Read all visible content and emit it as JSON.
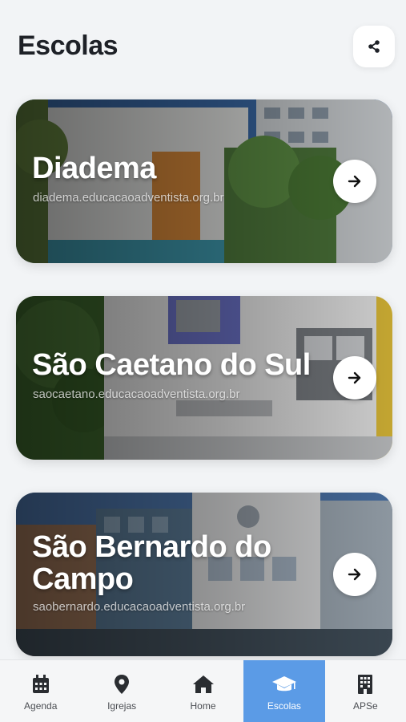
{
  "header": {
    "title": "Escolas",
    "share_icon": "share-icon"
  },
  "schools": [
    {
      "name": "Diadema",
      "url": "diadema.educacaoadventista.org.br",
      "action_icon": "arrow-right-icon"
    },
    {
      "name": "São Caetano do Sul",
      "url": "saocaetano.educacaoadventista.org.br",
      "action_icon": "arrow-right-icon"
    },
    {
      "name": "São Bernardo do Campo",
      "url": "saobernardo.educacaoadventista.org.br",
      "action_icon": "arrow-right-icon"
    }
  ],
  "tabbar": {
    "items": [
      {
        "label": "Agenda",
        "icon": "calendar-icon",
        "active": false
      },
      {
        "label": "Igrejas",
        "icon": "map-pin-icon",
        "active": false
      },
      {
        "label": "Home",
        "icon": "home-icon",
        "active": false
      },
      {
        "label": "Escolas",
        "icon": "graduation-cap-icon",
        "active": true
      },
      {
        "label": "APSe",
        "icon": "building-icon",
        "active": false
      }
    ],
    "active_color": "#5b9be6"
  }
}
